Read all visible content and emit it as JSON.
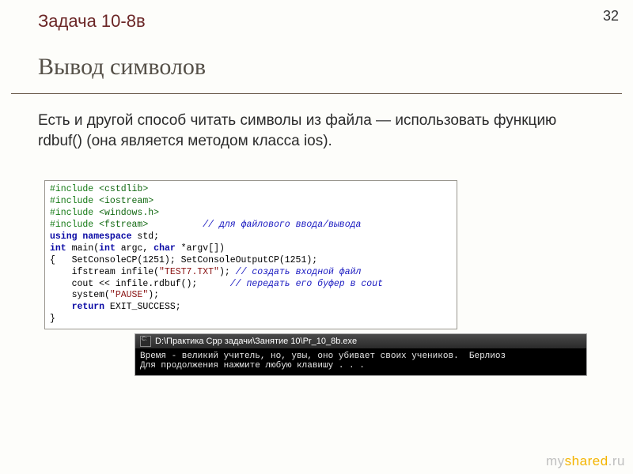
{
  "page_number": "32",
  "task_label": "Задача 10-8в",
  "title": "Вывод символов",
  "body_text": "Есть и другой способ читать символы из файла — использовать функцию rdbuf() (она является методом класса ios).",
  "code": {
    "l1a": "#include ",
    "l1b": "<cstdlib>",
    "l2a": "#include ",
    "l2b": "<iostream>",
    "l3a": "#include ",
    "l3b": "<windows.h>",
    "l4a": "#include ",
    "l4b": "<fstream>",
    "l4c": "          ",
    "l4d": "// для файлового ввода/вывода",
    "l5a": "using namespace",
    "l5b": " std;",
    "l6a": "int",
    "l6b": " main(",
    "l6c": "int",
    "l6d": " argc, ",
    "l6e": "char",
    "l6f": " *argv[])",
    "l7a": "{   SetConsoleCP(1251); SetConsoleOutputCP(1251);",
    "l8a": "    ifstream infile(",
    "l8b": "\"TEST7.TXT\"",
    "l8c": "); ",
    "l8d": "// создать входной файл",
    "l9a": "    cout << infile.rdbuf();      ",
    "l9d": "// передать его буфер в cout",
    "l10a": "    system(",
    "l10b": "\"PAUSE\"",
    "l10c": ");",
    "l11a": "    ",
    "l11b": "return",
    "l11c": " EXIT_SUCCESS;",
    "l12a": "}"
  },
  "console": {
    "title": "D:\\Практика Cpp задачи\\Занятие 10\\Pr_10_8b.exe",
    "line1": "Время - великий учитель, но, увы, оно убивает своих учеников.  Берлиоз",
    "line2": "Для продолжения нажмите любую клавишу . . ."
  },
  "watermark": {
    "my": "my",
    "shared": "shared",
    "ru": ".ru"
  }
}
